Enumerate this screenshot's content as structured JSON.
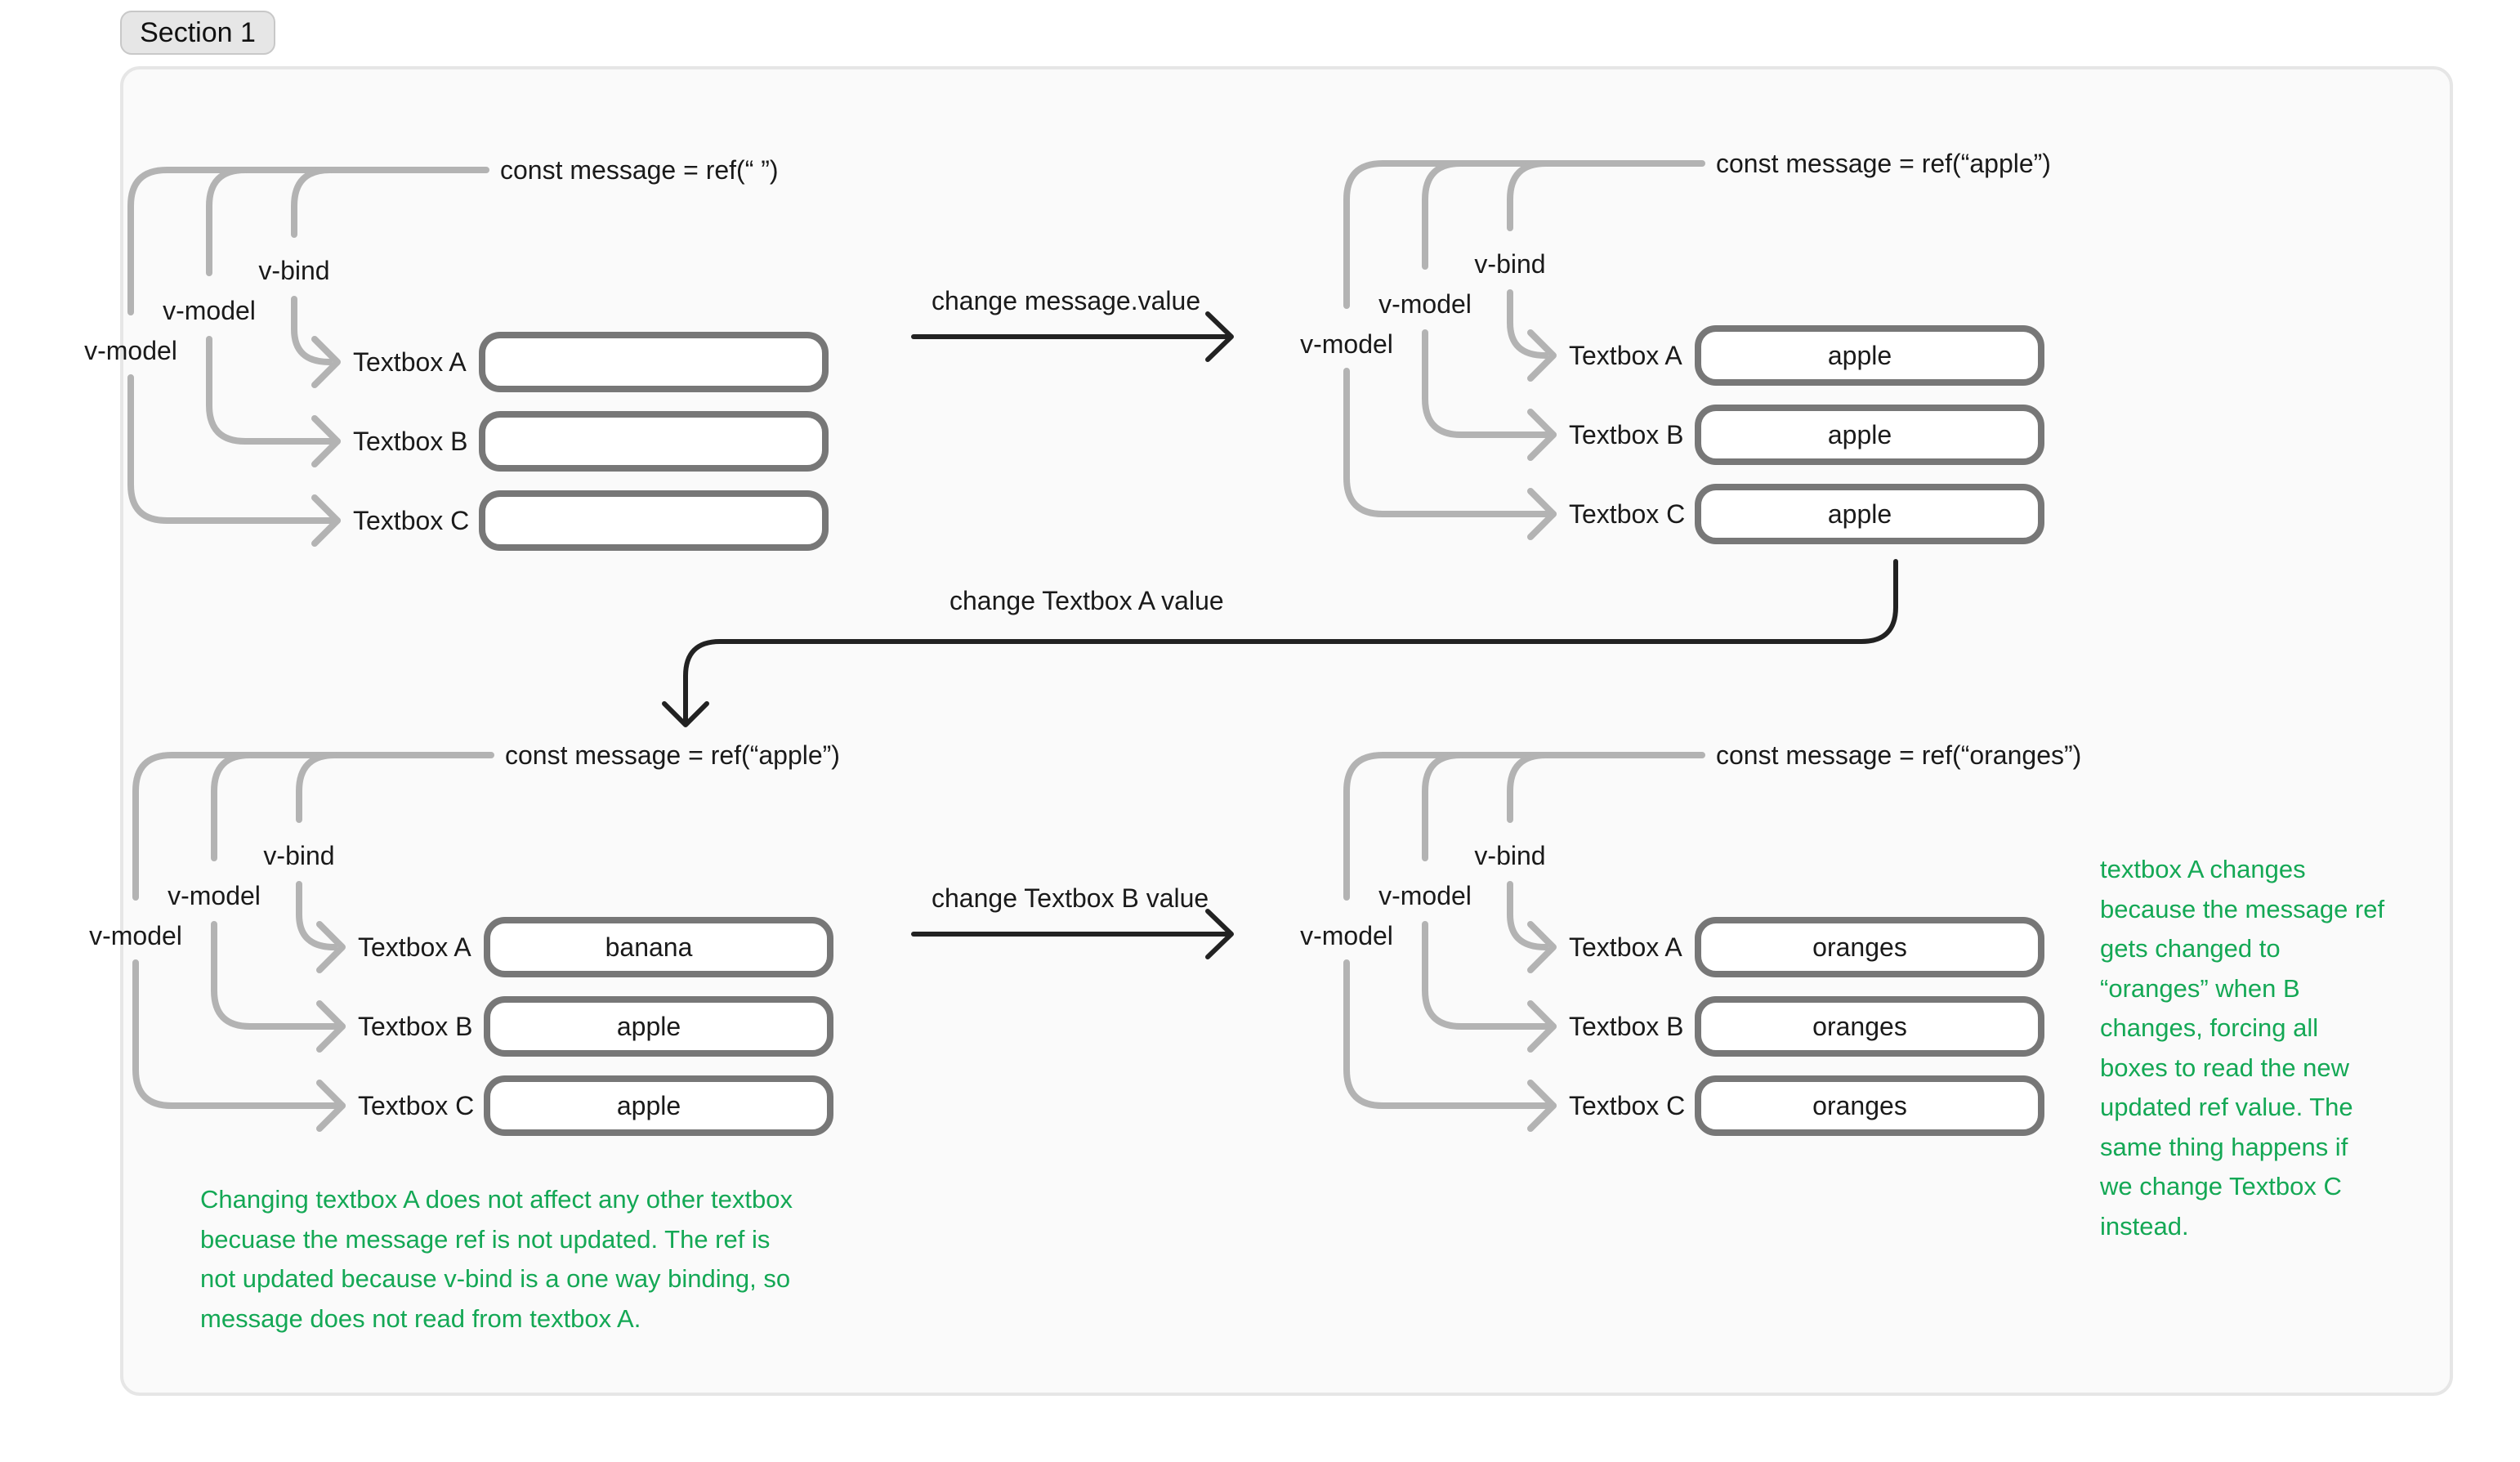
{
  "section": {
    "label": "Section 1"
  },
  "colors": {
    "binding_line": "#b3b3b3",
    "textbox_border": "#777777",
    "textbox_fill": "#ffffff",
    "arrow": "#222222",
    "text": "#1a1a1a",
    "note": "#14a855",
    "frame_bg": "#fafafa",
    "frame_border": "#e6e6e6"
  },
  "binding_labels": {
    "inner": "v-bind",
    "middle": "v-model",
    "outer": "v-model"
  },
  "diagrams": [
    {
      "id": "initial",
      "ref_label": "const message = ref(“ ”)",
      "textboxes": [
        {
          "label": "Textbox A",
          "binding": "v-bind",
          "value": ""
        },
        {
          "label": "Textbox B",
          "binding": "v-model",
          "value": ""
        },
        {
          "label": "Textbox C",
          "binding": "v-model",
          "value": ""
        }
      ]
    },
    {
      "id": "after-message-change",
      "ref_label": "const message = ref(“apple”)",
      "textboxes": [
        {
          "label": "Textbox A",
          "binding": "v-bind",
          "value": "apple"
        },
        {
          "label": "Textbox B",
          "binding": "v-model",
          "value": "apple"
        },
        {
          "label": "Textbox C",
          "binding": "v-model",
          "value": "apple"
        }
      ]
    },
    {
      "id": "after-textbox-a-change",
      "ref_label": "const message = ref(“apple”)",
      "textboxes": [
        {
          "label": "Textbox A",
          "binding": "v-bind",
          "value": "banana"
        },
        {
          "label": "Textbox B",
          "binding": "v-model",
          "value": "apple"
        },
        {
          "label": "Textbox C",
          "binding": "v-model",
          "value": "apple"
        }
      ]
    },
    {
      "id": "after-textbox-b-change",
      "ref_label": "const message = ref(“oranges”)",
      "textboxes": [
        {
          "label": "Textbox A",
          "binding": "v-bind",
          "value": "oranges"
        },
        {
          "label": "Textbox B",
          "binding": "v-model",
          "value": "oranges"
        },
        {
          "label": "Textbox C",
          "binding": "v-model",
          "value": "oranges"
        }
      ]
    }
  ],
  "transitions": [
    {
      "from": "initial",
      "to": "after-message-change",
      "label": "change message.value"
    },
    {
      "from": "after-message-change",
      "to": "after-textbox-a-change",
      "label": "change Textbox A value"
    },
    {
      "from": "after-textbox-a-change",
      "to": "after-textbox-b-change",
      "label": "change Textbox B value"
    }
  ],
  "notes": {
    "left": "Changing textbox A does not affect any other textbox\nbecuase the message ref is not updated. The ref is\nnot updated because v-bind is a one way binding, so\nmessage does not read from textbox A.",
    "right": "textbox A changes\nbecause the message ref\ngets changed to\n“oranges” when B\nchanges, forcing all\nboxes to read the new\nupdated ref value. The\nsame thing happens if\nwe change Textbox C\ninstead."
  }
}
